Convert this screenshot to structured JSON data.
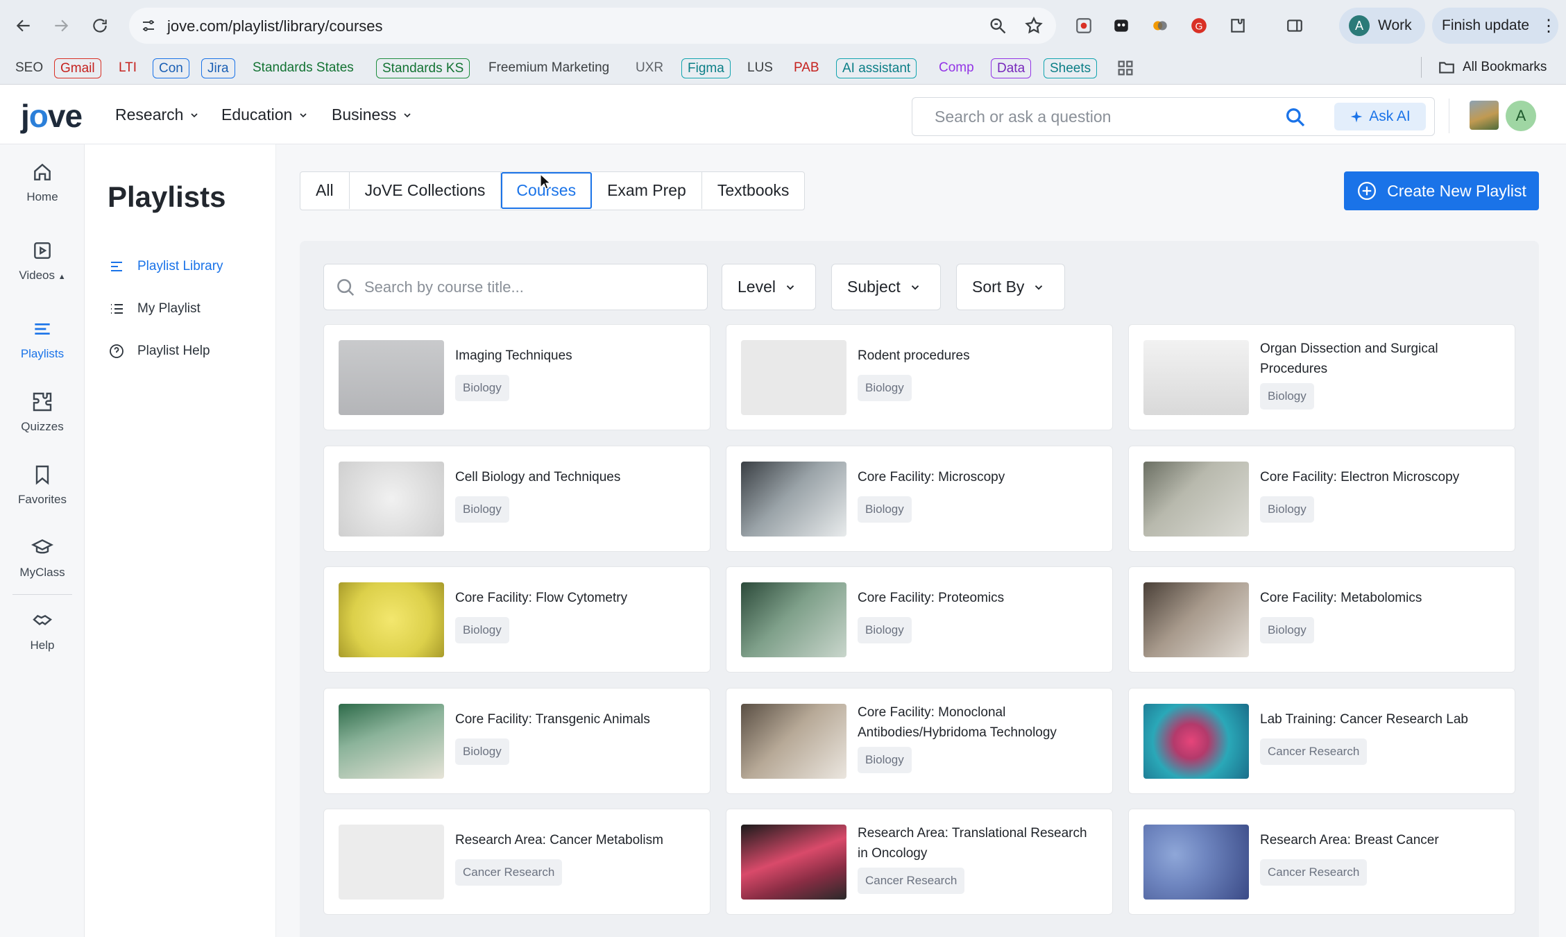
{
  "browser": {
    "url": "jove.com/playlist/library/courses",
    "profile_initial": "A",
    "profile_label": "Work",
    "update_label": "Finish update",
    "bookmarks": [
      {
        "label": "SEO",
        "style": "plain"
      },
      {
        "label": "Gmail",
        "style": "red"
      },
      {
        "label": "LTI",
        "style": "txt-red"
      },
      {
        "label": "Con",
        "style": "blue"
      },
      {
        "label": "Jira",
        "style": "blue"
      },
      {
        "label": "Standards States",
        "style": "txt-green"
      },
      {
        "label": "Standards KS",
        "style": "green"
      },
      {
        "label": "Freemium Marketing",
        "style": "plain"
      },
      {
        "label": "UXR",
        "style": "txt-grey"
      },
      {
        "label": "Figma",
        "style": "teal"
      },
      {
        "label": "LUS",
        "style": "plain"
      },
      {
        "label": "PAB",
        "style": "txt-red"
      },
      {
        "label": "AI assistant",
        "style": "teal"
      },
      {
        "label": "Comp",
        "style": "txt-purple"
      },
      {
        "label": "Data",
        "style": "purple"
      },
      {
        "label": "Sheets",
        "style": "teal"
      }
    ],
    "all_bookmarks_label": "All Bookmarks"
  },
  "header": {
    "logo_pre": "j",
    "logo_o": "o",
    "logo_post": "ve",
    "nav": [
      "Research",
      "Education",
      "Business"
    ],
    "search_placeholder": "Search or ask a question",
    "ask_ai_label": "Ask AI",
    "avatar_initial": "A"
  },
  "rail": [
    {
      "label": "Home",
      "icon": "home-icon"
    },
    {
      "label": "Videos",
      "icon": "video-icon"
    },
    {
      "label": "Playlists",
      "icon": "playlist-icon",
      "active": true
    },
    {
      "label": "Quizzes",
      "icon": "puzzle-icon"
    },
    {
      "label": "Favorites",
      "icon": "bookmark-icon"
    },
    {
      "label": "MyClass",
      "icon": "graduation-cap-icon"
    },
    {
      "label": "Help",
      "icon": "handshake-icon"
    }
  ],
  "sidebar": {
    "title": "Playlists",
    "links": [
      {
        "label": "Playlist Library",
        "active": true
      },
      {
        "label": "My Playlist"
      },
      {
        "label": "Playlist Help"
      }
    ]
  },
  "tabs": [
    {
      "label": "All"
    },
    {
      "label": "JoVE Collections"
    },
    {
      "label": "Courses",
      "active": true
    },
    {
      "label": "Exam Prep"
    },
    {
      "label": "Textbooks"
    }
  ],
  "create_label": "Create New Playlist",
  "filters": {
    "search_placeholder": "Search by course title...",
    "level": "Level",
    "subject": "Subject",
    "sort": "Sort By"
  },
  "courses": [
    {
      "title": "Imaging Techniques",
      "tag": "Biology"
    },
    {
      "title": "Rodent procedures",
      "tag": "Biology"
    },
    {
      "title": "Organ Dissection and Surgical Procedures",
      "tag": "Biology"
    },
    {
      "title": "Cell Biology and Techniques",
      "tag": "Biology"
    },
    {
      "title": "Core Facility: Microscopy",
      "tag": "Biology"
    },
    {
      "title": "Core Facility: Electron Microscopy",
      "tag": "Biology"
    },
    {
      "title": "Core Facility: Flow Cytometry",
      "tag": "Biology"
    },
    {
      "title": "Core Facility: Proteomics",
      "tag": "Biology"
    },
    {
      "title": "Core Facility: Metabolomics",
      "tag": "Biology"
    },
    {
      "title": "Core Facility: Transgenic Animals",
      "tag": "Biology"
    },
    {
      "title": "Core Facility: Monoclonal Antibodies/Hybridoma Technology",
      "tag": "Biology"
    },
    {
      "title": "Lab Training: Cancer Research Lab",
      "tag": "Cancer Research"
    },
    {
      "title": "Research Area: Cancer Metabolism",
      "tag": "Cancer Research"
    },
    {
      "title": "Research Area: Translational Research in Oncology",
      "tag": "Cancer Research"
    },
    {
      "title": "Research Area: Breast Cancer",
      "tag": "Cancer Research"
    }
  ]
}
